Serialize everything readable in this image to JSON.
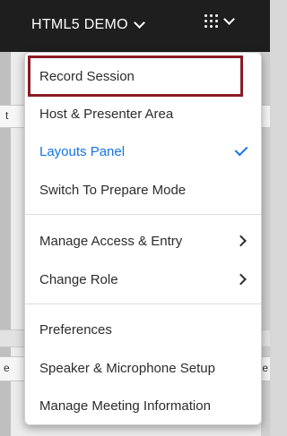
{
  "header": {
    "meeting_title": "HTML5 DEMO"
  },
  "background": {
    "left_fragment_1": "t",
    "left_fragment_2": "e",
    "right_fragment": "te"
  },
  "menu": {
    "items": [
      {
        "label": "Record Session"
      },
      {
        "label": "Host & Presenter Area"
      },
      {
        "label": "Layouts Panel",
        "checked": true
      },
      {
        "label": "Switch To Prepare Mode"
      },
      {
        "label": "Manage Access & Entry",
        "submenu": true
      },
      {
        "label": "Change Role",
        "submenu": true
      },
      {
        "label": "Preferences"
      },
      {
        "label": "Speaker & Microphone Setup"
      },
      {
        "label": "Manage Meeting Information"
      }
    ]
  },
  "colors": {
    "accent": "#1473e6",
    "highlight_border": "#8b1c24",
    "topbar": "#1e1e1e"
  }
}
